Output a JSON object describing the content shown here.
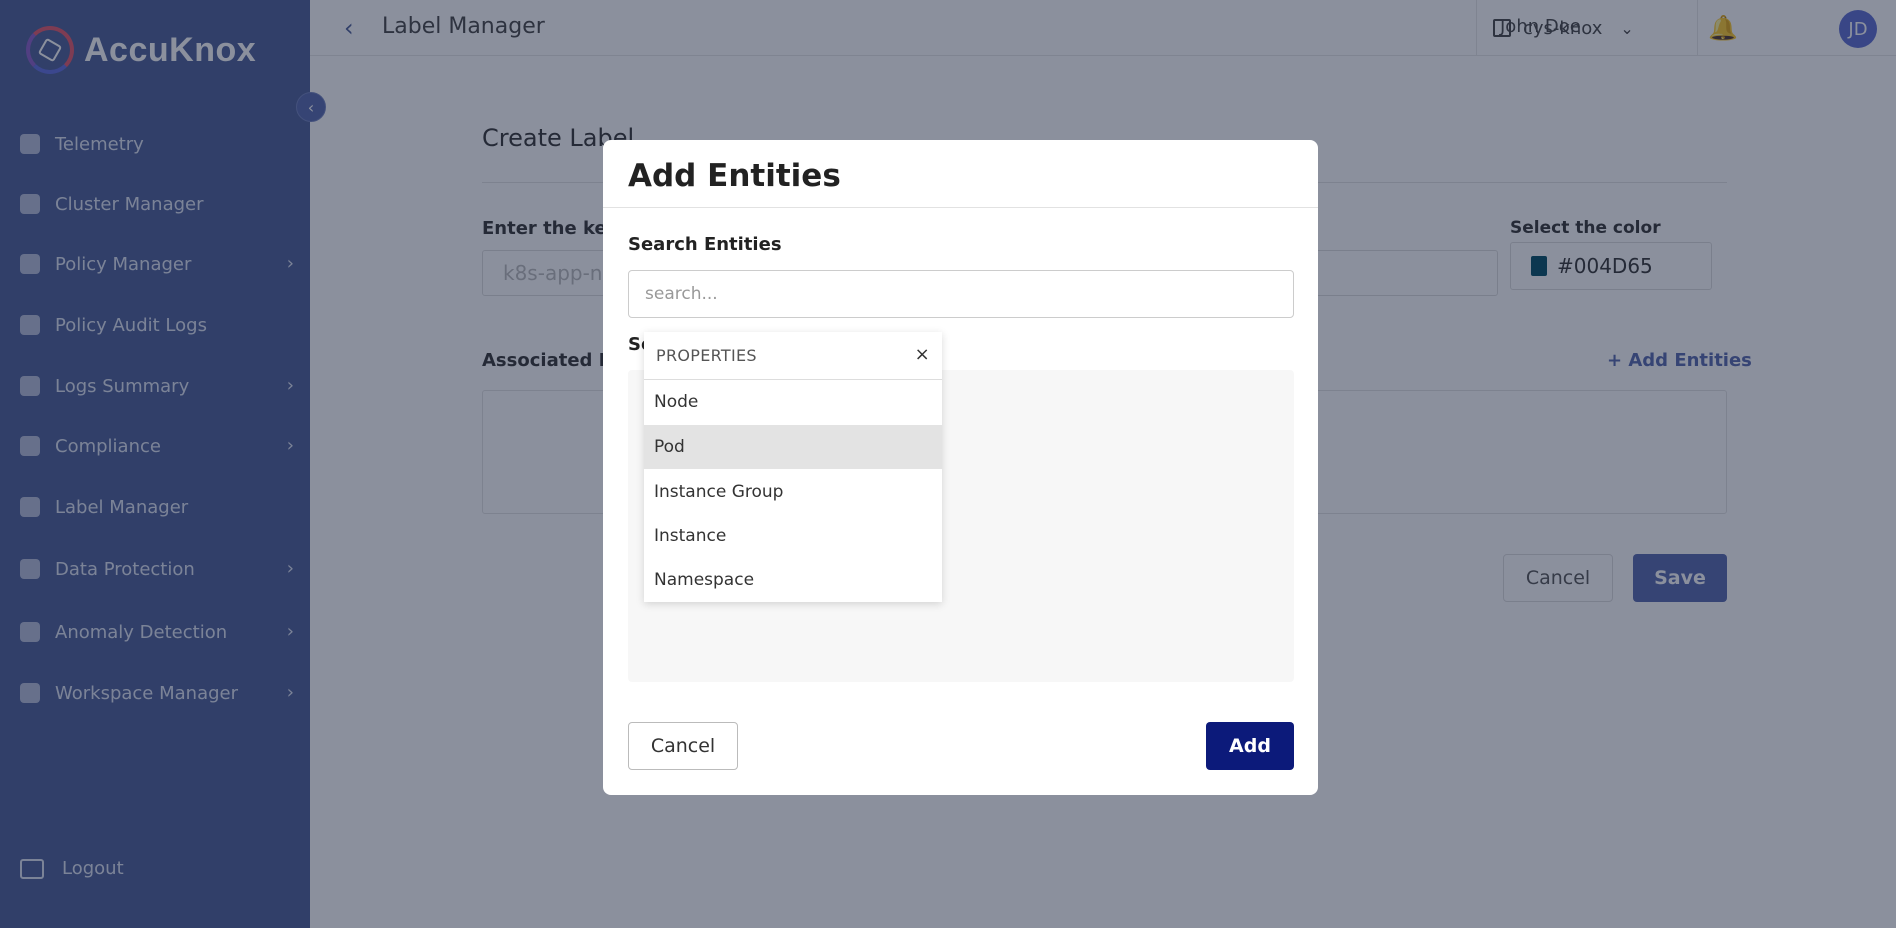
{
  "brand": {
    "name": "AccuKnox"
  },
  "sidebar": {
    "collapse_icon": "chevron-left",
    "items": [
      {
        "label": "Telemetry",
        "icon": "telemetry-icon",
        "has_submenu": false
      },
      {
        "label": "Cluster Manager",
        "icon": "cluster-icon",
        "has_submenu": false
      },
      {
        "label": "Policy Manager",
        "icon": "shield-icon",
        "has_submenu": true
      },
      {
        "label": "Policy Audit Logs",
        "icon": "bolt-icon",
        "has_submenu": false
      },
      {
        "label": "Logs Summary",
        "icon": "bar-chart-icon",
        "has_submenu": true
      },
      {
        "label": "Compliance",
        "icon": "checklist-icon",
        "has_submenu": true
      },
      {
        "label": "Label Manager",
        "icon": "tag-icon",
        "has_submenu": false
      },
      {
        "label": "Data Protection",
        "icon": "cloud-lock-icon",
        "has_submenu": true
      },
      {
        "label": "Anomaly Detection",
        "icon": "radar-icon",
        "has_submenu": true
      },
      {
        "label": "Workspace Manager",
        "icon": "briefcase-icon",
        "has_submenu": true
      }
    ],
    "logout_label": "Logout"
  },
  "header": {
    "title": "Label Manager",
    "workspace": "cys-knox",
    "user_name": "John Doe",
    "user_initials": "JD"
  },
  "form": {
    "title": "Create Label",
    "key_label": "Enter the key",
    "key_required_mark": "*",
    "key_placeholder": "k8s-app-n",
    "color_label": "Select the color",
    "color_value": "#004D65",
    "associated_label": "Associated En",
    "add_entities_link": "+ Add Entities",
    "cancel_label": "Cancel",
    "save_label": "Save"
  },
  "modal": {
    "title": "Add Entities",
    "search_label": "Search Entities",
    "search_placeholder": "search...",
    "selected_label": "Se",
    "cancel_label": "Cancel",
    "add_label": "Add",
    "add_color": "#0c1a7a"
  },
  "dropdown": {
    "header": "PROPERTIES",
    "close_glyph": "×",
    "items": [
      {
        "label": "Node",
        "active": false
      },
      {
        "label": "Pod",
        "active": true
      },
      {
        "label": "Instance Group",
        "active": false
      },
      {
        "label": "Instance",
        "active": false
      },
      {
        "label": "Namespace",
        "active": false
      }
    ]
  },
  "colors": {
    "sidebar_bg": "#4a5d96",
    "accent": "#5466ad",
    "primary_button": "#0c1a7a",
    "label_color_swatch": "#004D65"
  }
}
